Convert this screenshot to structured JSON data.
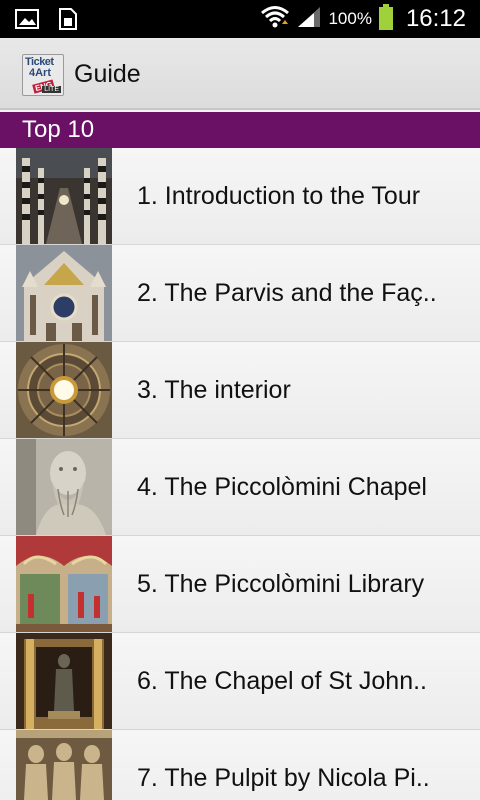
{
  "status_bar": {
    "battery_percent": "100%",
    "time": "16:12",
    "icons": [
      "image-icon",
      "sim-card-icon",
      "wifi-icon",
      "signal-icon",
      "battery-icon"
    ]
  },
  "action_bar": {
    "logo": {
      "line1": "Ticket",
      "line2": "4Art",
      "lang": "ENG",
      "edition": "LITE"
    },
    "title": "Guide"
  },
  "section": {
    "title": "Top 10",
    "color": "#6a1166"
  },
  "items": [
    {
      "label": "1. Introduction to the Tour",
      "thumb": "cathedral-nave-thumbnail"
    },
    {
      "label": "2. The Parvis and the Faç..",
      "thumb": "cathedral-facade-thumbnail"
    },
    {
      "label": "3. The interior",
      "thumb": "dome-interior-thumbnail"
    },
    {
      "label": "4. The Piccolòmini Chapel",
      "thumb": "saint-statue-thumbnail"
    },
    {
      "label": "5. The Piccolòmini Library",
      "thumb": "library-frescoes-thumbnail"
    },
    {
      "label": "6. The Chapel of St John..",
      "thumb": "chapel-statue-thumbnail"
    },
    {
      "label": "7. The Pulpit by Nicola Pi..",
      "thumb": "pulpit-relief-thumbnail"
    }
  ]
}
